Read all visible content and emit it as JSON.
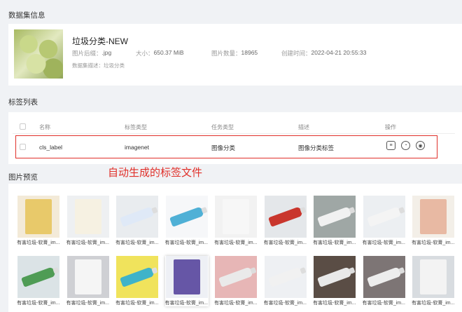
{
  "dataset_section_title": "数据集信息",
  "dataset": {
    "name": "垃圾分类-NEW",
    "ext_label": "图片后缀：",
    "ext_value": ".jpg",
    "size_label": "大小：",
    "size_value": "650.37 MiB",
    "count_label": "图片数量：",
    "count_value": "18965",
    "created_label": "创建时间：",
    "created_value": "2022-04-21 20:55:33",
    "desc": "数据集描述：垃圾分类"
  },
  "label_section_title": "标签列表",
  "label_table": {
    "headers": [
      "名称",
      "标签类型",
      "任务类型",
      "描述",
      "操作"
    ],
    "rows": [
      {
        "name": "cls_label",
        "type": "imagenet",
        "task": "图像分类",
        "desc": "图像分类标签"
      }
    ]
  },
  "annotation": "自动生成的标签文件",
  "preview_section_title": "图片预览",
  "preview_caption": "有害垃圾-软膏_im...",
  "accent_red": "#e0302a",
  "tile_count": 18
}
